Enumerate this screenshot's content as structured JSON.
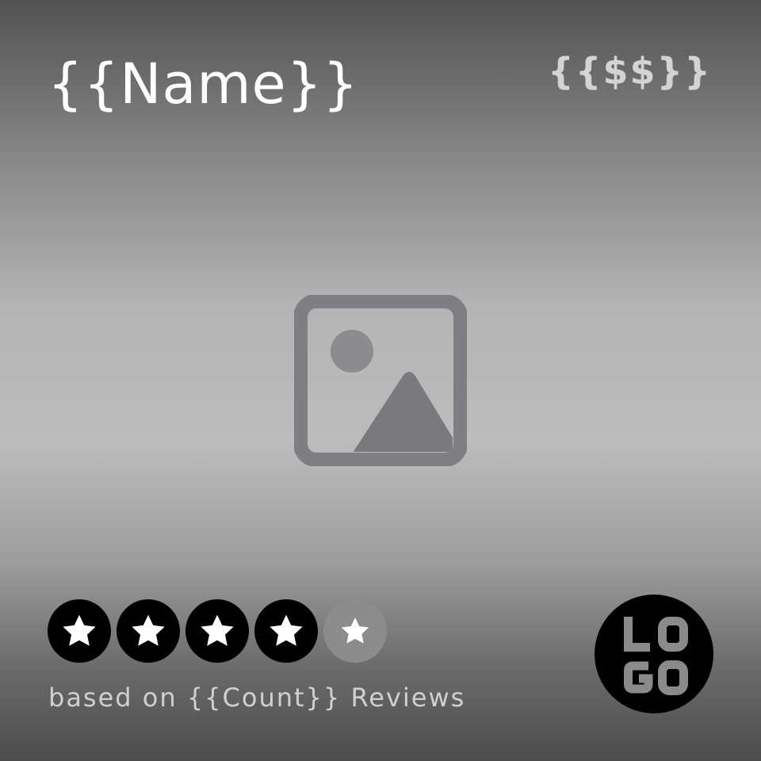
{
  "card": {
    "name": "{{Name}}",
    "price": "{{$$}}",
    "reviews_text": "based on {{Count}} Reviews",
    "logo_text": "LOGO"
  },
  "rating": {
    "value": 4,
    "max": 5
  },
  "icons": {
    "image_placeholder": "image-placeholder-icon",
    "star": "star-icon"
  },
  "colors": {
    "star_filled_bg": "#000000",
    "star_empty_bg": "#8c8c8c",
    "logo_bg": "#000000",
    "logo_text": "#8a8a8a",
    "placeholder_icon": "#7f7f83"
  }
}
